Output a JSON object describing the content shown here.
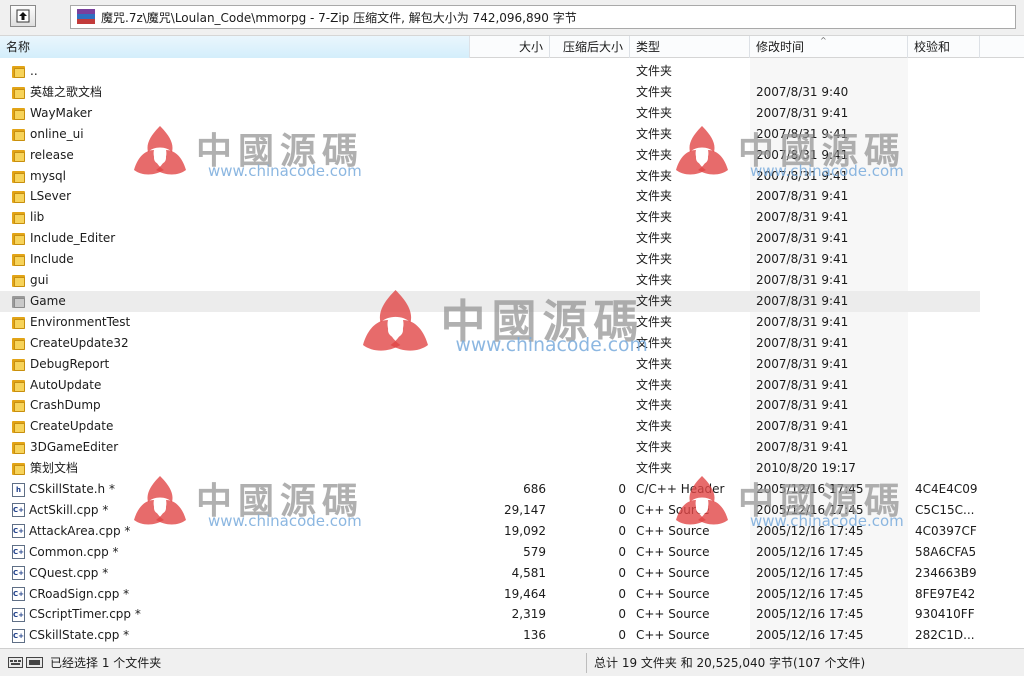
{
  "window": {
    "address": "魔咒.7z\\魔咒\\Loulan_Code\\mmorpg - 7-Zip 压缩文件, 解包大小为 742,096,890 字节"
  },
  "columns": {
    "name": "名称",
    "size": "大小",
    "packed": "压缩后大小",
    "type": "类型",
    "modified": "修改时间",
    "crc": "校验和"
  },
  "rows": [
    {
      "name": "..",
      "icon": "folder-icon",
      "size": "",
      "packed": "",
      "type": "文件夹",
      "modified": "",
      "crc": ""
    },
    {
      "name": "英雄之歌文档",
      "icon": "folder-icon",
      "size": "",
      "packed": "",
      "type": "文件夹",
      "modified": "2007/8/31 9:40",
      "crc": ""
    },
    {
      "name": "WayMaker",
      "icon": "folder-icon",
      "size": "",
      "packed": "",
      "type": "文件夹",
      "modified": "2007/8/31 9:41",
      "crc": ""
    },
    {
      "name": "online_ui",
      "icon": "folder-icon",
      "size": "",
      "packed": "",
      "type": "文件夹",
      "modified": "2007/8/31 9:41",
      "crc": ""
    },
    {
      "name": "release",
      "icon": "folder-icon",
      "size": "",
      "packed": "",
      "type": "文件夹",
      "modified": "2007/8/31 9:41",
      "crc": ""
    },
    {
      "name": "mysql",
      "icon": "folder-icon",
      "size": "",
      "packed": "",
      "type": "文件夹",
      "modified": "2007/8/31 9:41",
      "crc": ""
    },
    {
      "name": "LSever",
      "icon": "folder-icon",
      "size": "",
      "packed": "",
      "type": "文件夹",
      "modified": "2007/8/31 9:41",
      "crc": ""
    },
    {
      "name": "lib",
      "icon": "folder-icon",
      "size": "",
      "packed": "",
      "type": "文件夹",
      "modified": "2007/8/31 9:41",
      "crc": ""
    },
    {
      "name": "Include_Editer",
      "icon": "folder-icon",
      "size": "",
      "packed": "",
      "type": "文件夹",
      "modified": "2007/8/31 9:41",
      "crc": ""
    },
    {
      "name": "Include",
      "icon": "folder-icon",
      "size": "",
      "packed": "",
      "type": "文件夹",
      "modified": "2007/8/31 9:41",
      "crc": ""
    },
    {
      "name": "gui",
      "icon": "folder-icon",
      "size": "",
      "packed": "",
      "type": "文件夹",
      "modified": "2007/8/31 9:41",
      "crc": ""
    },
    {
      "name": "Game",
      "icon": "folder-icon",
      "size": "",
      "packed": "",
      "type": "文件夹",
      "modified": "2007/8/31 9:41",
      "crc": "",
      "selected": true
    },
    {
      "name": "EnvironmentTest",
      "icon": "folder-icon",
      "size": "",
      "packed": "",
      "type": "文件夹",
      "modified": "2007/8/31 9:41",
      "crc": ""
    },
    {
      "name": "CreateUpdate32",
      "icon": "folder-icon",
      "size": "",
      "packed": "",
      "type": "文件夹",
      "modified": "2007/8/31 9:41",
      "crc": ""
    },
    {
      "name": "DebugReport",
      "icon": "folder-icon",
      "size": "",
      "packed": "",
      "type": "文件夹",
      "modified": "2007/8/31 9:41",
      "crc": ""
    },
    {
      "name": "AutoUpdate",
      "icon": "folder-icon",
      "size": "",
      "packed": "",
      "type": "文件夹",
      "modified": "2007/8/31 9:41",
      "crc": ""
    },
    {
      "name": "CrashDump",
      "icon": "folder-icon",
      "size": "",
      "packed": "",
      "type": "文件夹",
      "modified": "2007/8/31 9:41",
      "crc": ""
    },
    {
      "name": "CreateUpdate",
      "icon": "folder-icon",
      "size": "",
      "packed": "",
      "type": "文件夹",
      "modified": "2007/8/31 9:41",
      "crc": ""
    },
    {
      "name": "3DGameEditer",
      "icon": "folder-icon",
      "size": "",
      "packed": "",
      "type": "文件夹",
      "modified": "2007/8/31 9:41",
      "crc": ""
    },
    {
      "name": "策划文档",
      "icon": "folder-icon",
      "size": "",
      "packed": "",
      "type": "文件夹",
      "modified": "2010/8/20 19:17",
      "crc": ""
    },
    {
      "name": "CSkillState.h *",
      "icon": "header-file-icon",
      "size": "686",
      "packed": "0",
      "type": "C/C++ Header",
      "modified": "2005/12/16 17:45",
      "crc": "4C4E4C09"
    },
    {
      "name": "ActSkill.cpp *",
      "icon": "cpp-file-icon",
      "size": "29,147",
      "packed": "0",
      "type": "C++ Source",
      "modified": "2005/12/16 17:45",
      "crc": "C5C15C..."
    },
    {
      "name": "AttackArea.cpp *",
      "icon": "cpp-file-icon",
      "size": "19,092",
      "packed": "0",
      "type": "C++ Source",
      "modified": "2005/12/16 17:45",
      "crc": "4C0397CF"
    },
    {
      "name": "Common.cpp *",
      "icon": "cpp-file-icon",
      "size": "579",
      "packed": "0",
      "type": "C++ Source",
      "modified": "2005/12/16 17:45",
      "crc": "58A6CFA5"
    },
    {
      "name": "CQuest.cpp *",
      "icon": "cpp-file-icon",
      "size": "4,581",
      "packed": "0",
      "type": "C++ Source",
      "modified": "2005/12/16 17:45",
      "crc": "234663B9"
    },
    {
      "name": "CRoadSign.cpp *",
      "icon": "cpp-file-icon",
      "size": "19,464",
      "packed": "0",
      "type": "C++ Source",
      "modified": "2005/12/16 17:45",
      "crc": "8FE97E42"
    },
    {
      "name": "CScriptTimer.cpp *",
      "icon": "cpp-file-icon",
      "size": "2,319",
      "packed": "0",
      "type": "C++ Source",
      "modified": "2005/12/16 17:45",
      "crc": "930410FF"
    },
    {
      "name": "CSkillState.cpp *",
      "icon": "cpp-file-icon",
      "size": "136",
      "packed": "0",
      "type": "C++ Source",
      "modified": "2005/12/16 17:45",
      "crc": "282C1D..."
    }
  ],
  "status": {
    "selection": "已经选择 1 个文件夹",
    "summary": "总计 19 文件夹 和 20,525,040 字节(107 个文件)"
  },
  "watermark": {
    "name": "中國源碼",
    "url": "www.chinacode.com"
  }
}
